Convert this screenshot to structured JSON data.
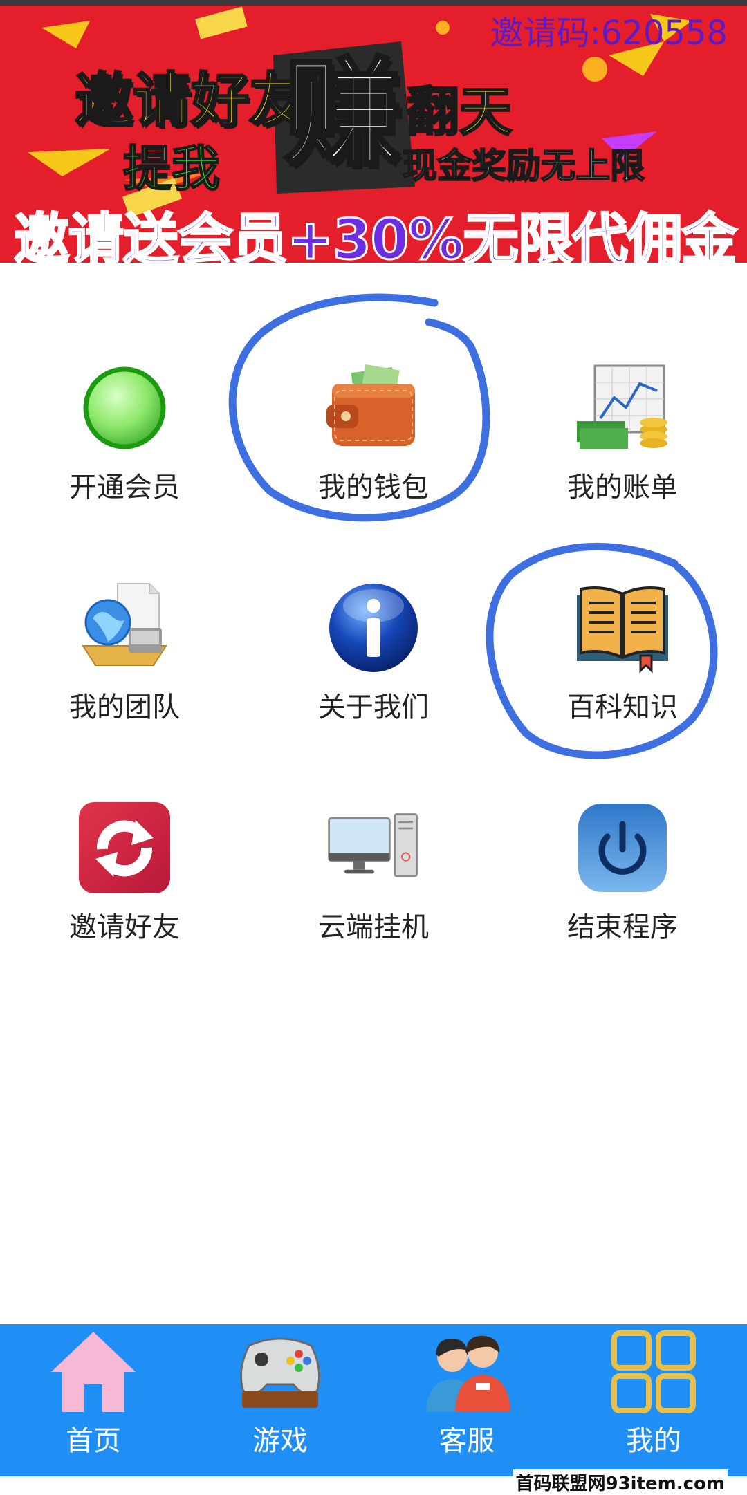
{
  "banner": {
    "invite_code": "邀请码:620558",
    "headline_left": "邀请好友",
    "headline_zhuan": "赚",
    "headline_right": "翻天",
    "headline_tiwo": "提我",
    "headline_reward": "现金奖励无上限",
    "headline_bottom": "邀请送会员+30%无限代佣金"
  },
  "grid": {
    "items": [
      {
        "label": "开通会员",
        "icon": "green-circle-icon"
      },
      {
        "label": "我的钱包",
        "icon": "wallet-icon"
      },
      {
        "label": "我的账单",
        "icon": "bill-chart-icon"
      },
      {
        "label": "我的团队",
        "icon": "team-network-icon"
      },
      {
        "label": "关于我们",
        "icon": "info-icon"
      },
      {
        "label": "百科知识",
        "icon": "book-icon"
      },
      {
        "label": "邀请好友",
        "icon": "refresh-icon"
      },
      {
        "label": "云端挂机",
        "icon": "computer-icon"
      },
      {
        "label": "结束程序",
        "icon": "power-icon"
      }
    ]
  },
  "tabbar": {
    "items": [
      {
        "label": "首页",
        "icon": "home-icon"
      },
      {
        "label": "游戏",
        "icon": "gamepad-icon"
      },
      {
        "label": "客服",
        "icon": "customer-service-icon"
      },
      {
        "label": "我的",
        "icon": "grid-squares-icon"
      }
    ]
  },
  "watermark": "首码联盟网93item.com",
  "colors": {
    "banner_bg": "#e41e2a",
    "tabbar_bg": "#1f8ef5",
    "annotation": "#3d6fe0"
  }
}
